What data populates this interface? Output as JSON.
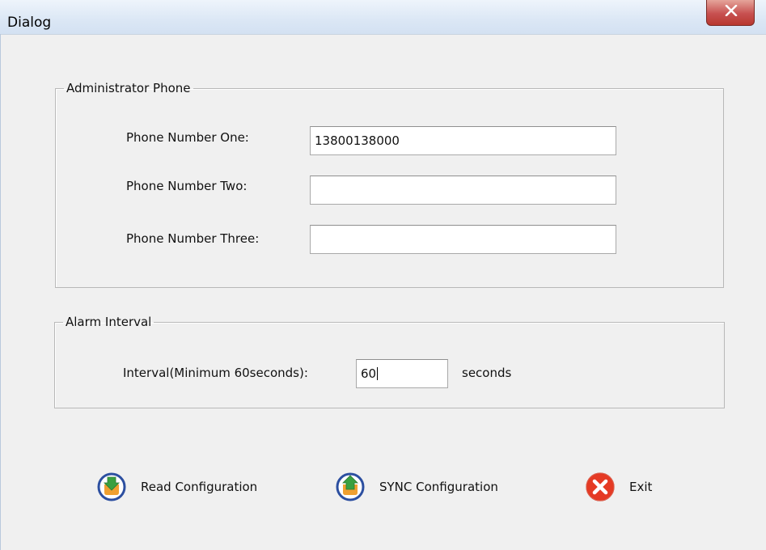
{
  "window": {
    "title": "Dialog",
    "close_icon": "close-x-icon"
  },
  "admin_group": {
    "legend": "Administrator Phone",
    "phone_one": {
      "label": "Phone Number One:",
      "value": "13800138000"
    },
    "phone_two": {
      "label": "Phone Number Two:",
      "value": ""
    },
    "phone_three": {
      "label": "Phone Number Three:",
      "value": ""
    }
  },
  "alarm_group": {
    "legend": "Alarm Interval",
    "interval_label": "Interval(Minimum 60seconds):",
    "interval_value": "60",
    "unit": "seconds"
  },
  "buttons": {
    "read": {
      "label": "Read Configuration",
      "icon": "download-arrow-icon"
    },
    "sync": {
      "label": "SYNC Configuration",
      "icon": "upload-arrow-icon"
    },
    "exit": {
      "label": "Exit",
      "icon": "red-x-circle-icon"
    }
  },
  "colors": {
    "icon_orange": "#f0a030",
    "icon_green": "#3aa040",
    "icon_ring": "#2c4fa0",
    "exit_red": "#e53a24"
  }
}
